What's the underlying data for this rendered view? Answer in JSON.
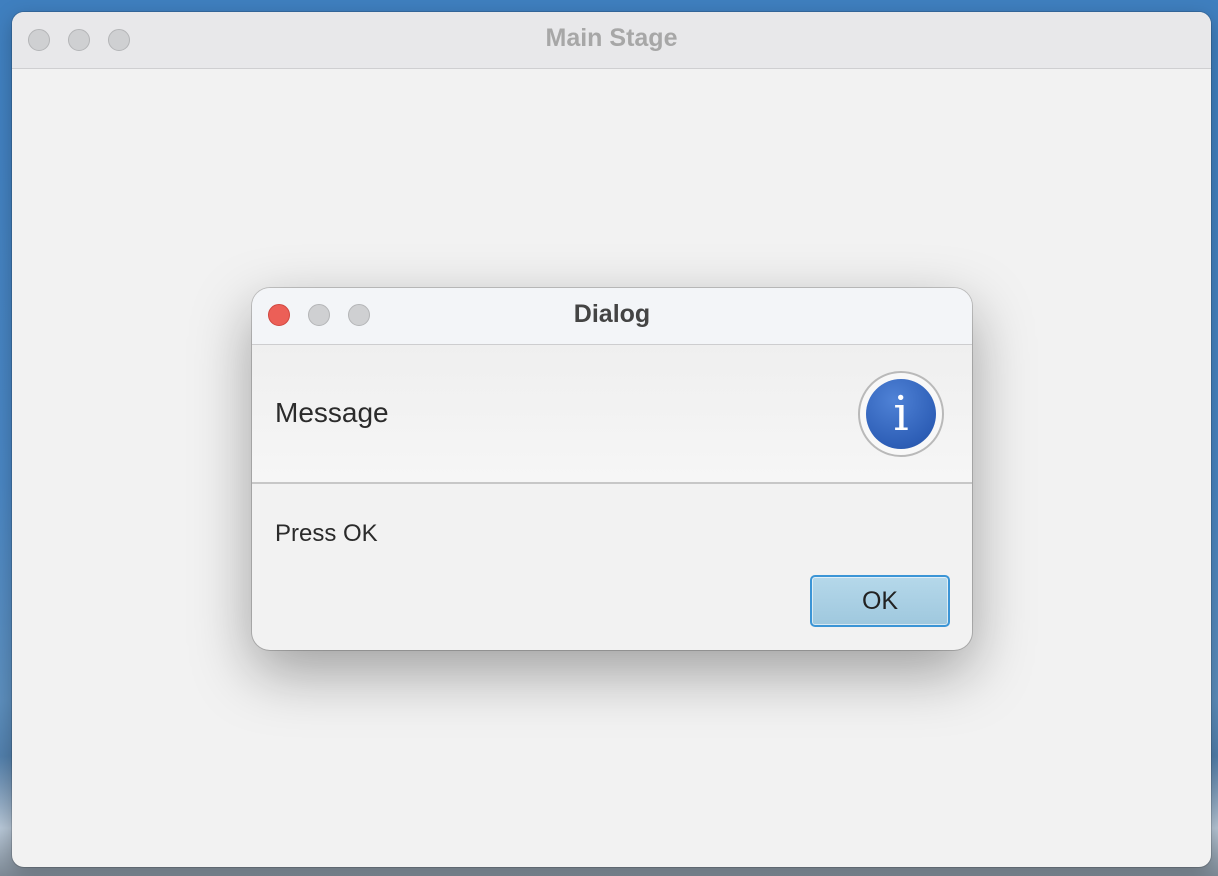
{
  "main_window": {
    "title": "Main Stage"
  },
  "dialog": {
    "title": "Dialog",
    "header_text": "Message",
    "header_icon": "info-icon",
    "info_glyph": "i",
    "content_text": "Press OK",
    "ok_label": "OK"
  },
  "colors": {
    "close_button_active": "#ec5f57",
    "traffic_inactive": "#cfd0d2",
    "ok_button_fill": "#a8cfe3",
    "ok_button_border": "#3b95d6",
    "info_icon_blue": "#2e5fb7"
  }
}
